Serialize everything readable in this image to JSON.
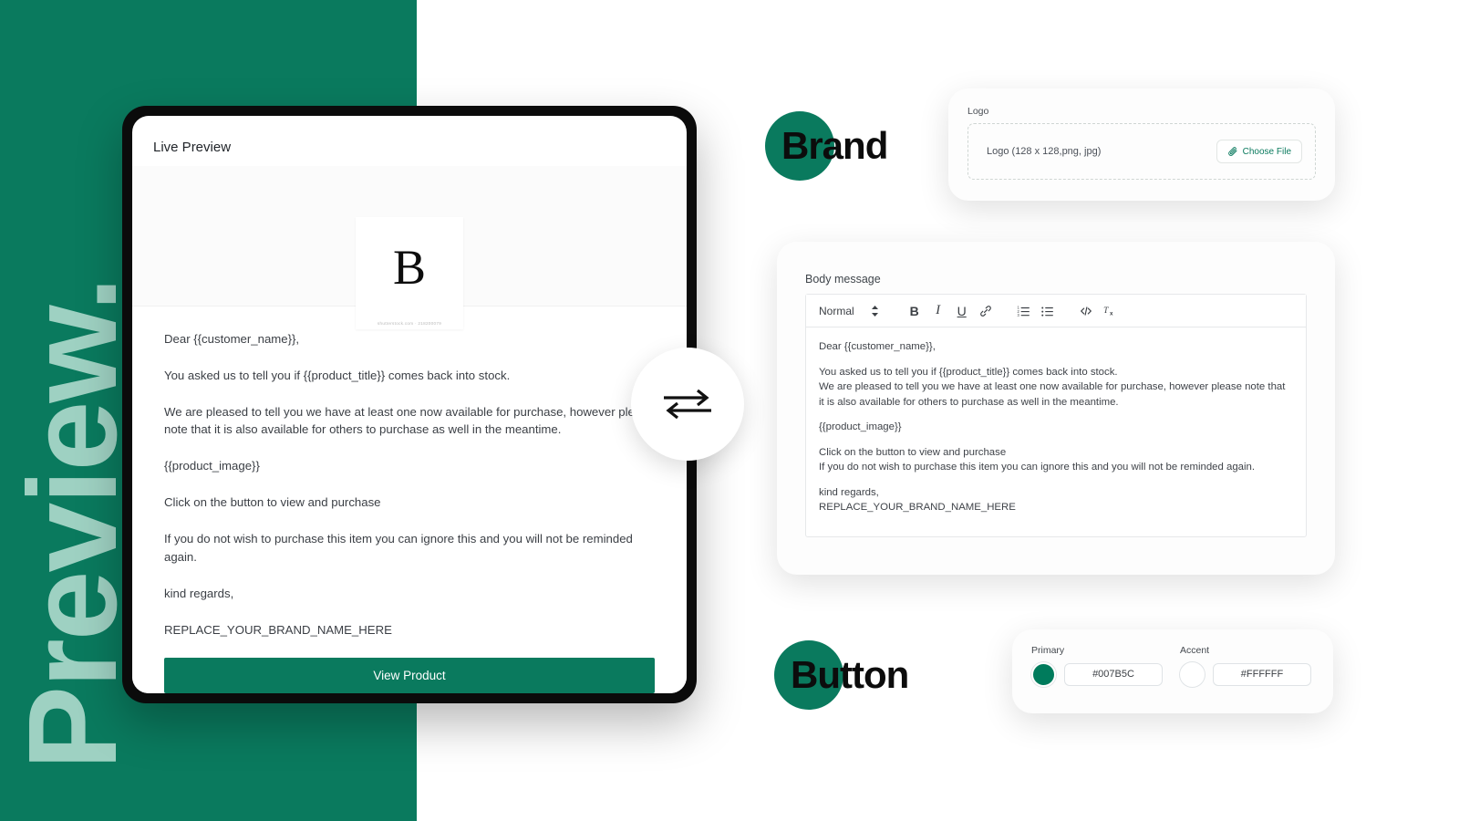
{
  "banner": {
    "word": "Preview."
  },
  "colors": {
    "primary": "#007B5C",
    "accent": "#FFFFFF",
    "brand_green": "#0a7a5e",
    "banner_text": "#9ed1c2"
  },
  "preview": {
    "title": "Live Preview",
    "logo_letter": "B",
    "logo_watermark": "shutterstock.com · 218200079",
    "paragraphs": [
      "Dear {{customer_name}},",
      "You asked us to tell you if {{product_title}} comes back into stock.",
      "We are pleased to tell you we have at least one now available for purchase, however please note that it is also available for others to purchase as well in the meantime.",
      "{{product_image}}",
      "Click on the button to view and purchase",
      "If you do not wish to purchase this item you can ignore this and you will not be reminded again.",
      "kind regards,",
      "REPLACE_YOUR_BRAND_NAME_HERE"
    ],
    "cta_label": "View Product"
  },
  "sync": {
    "icon": "sync-arrows-icon"
  },
  "brand_chip": {
    "label": "Brand"
  },
  "button_chip": {
    "label": "Button"
  },
  "logo_card": {
    "label": "Logo",
    "dropzone_text": "Logo (128 x 128,png, jpg)",
    "choose_file_label": "Choose File",
    "choose_file_icon": "paperclip-icon"
  },
  "editor": {
    "label": "Body message",
    "toolbar": {
      "format_value": "Normal",
      "buttons": [
        {
          "name": "bold-button",
          "glyph": "B"
        },
        {
          "name": "italic-button",
          "glyph": "I"
        },
        {
          "name": "underline-button",
          "glyph": "U"
        },
        {
          "name": "link-button",
          "glyph": "link-icon"
        },
        {
          "name": "ordered-list-button",
          "glyph": "ordered-list-icon"
        },
        {
          "name": "bullet-list-button",
          "glyph": "bullet-list-icon"
        },
        {
          "name": "code-button",
          "glyph": "code-icon"
        },
        {
          "name": "clear-format-button",
          "glyph": "clear-format-icon"
        }
      ]
    },
    "paragraphs": [
      "Dear {{customer_name}},",
      "You asked us to tell you if {{product_title}} comes back into stock.\nWe are pleased to tell you we have at least one now available for purchase, however please note that it is also available for others to purchase as well in the meantime.",
      "{{product_image}}",
      "Click on the button to view and purchase\nIf you do not wish to purchase this item you can ignore this and you will not be reminded again.",
      "kind regards,\nREPLACE_YOUR_BRAND_NAME_HERE"
    ]
  },
  "color_card": {
    "primary_label": "Primary",
    "primary_value": "#007B5C",
    "accent_label": "Accent",
    "accent_value": "#FFFFFF"
  }
}
